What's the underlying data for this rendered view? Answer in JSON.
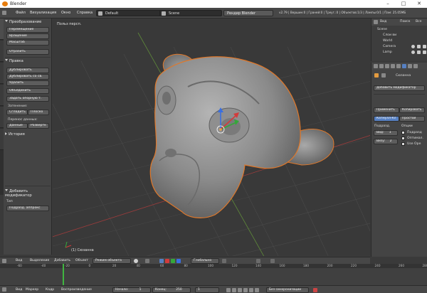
{
  "window": {
    "title": "Blender"
  },
  "menu": {
    "items": [
      "Файл",
      "Визуализация",
      "Окно",
      "Справка"
    ],
    "layout": "Default",
    "scene": "Scene",
    "engine": "Рендер Blender",
    "stats": "v2.79 | Вершин:0 | Граней:0 | Треуг.:0 | Объектов:1/3 | Лампы:0/1 | Пам: 25.05МБ"
  },
  "tools": {
    "transform_header": "Преобразование",
    "move": "Перемещение",
    "rotate": "Вращение",
    "scale": "Масштаб",
    "mirror": "Отразить",
    "edit_header": "Правка",
    "duplicate": "Дублировать",
    "duplicate_linked": "Дублировать со св.",
    "delete": "Удалить",
    "join": "Объединить",
    "set_origin": "Задать опорную т.",
    "shading_label": "Затенение:",
    "smooth": "Сгладить",
    "flat": "Плоско",
    "data_transfer_label": "Перенос данных:",
    "data": "Данные",
    "layout_btn": "Развёртк",
    "history_header": "История",
    "add_modifier_header": "Добавить модификатор",
    "type_label": "Тип",
    "type_value": "Подразд. аппрокс"
  },
  "viewport": {
    "view_label": "Польз персп.",
    "object_label": "(1) Сюзанна",
    "header": {
      "view": "Вид",
      "select": "Выделение",
      "add": "Добавить",
      "object": "Объект",
      "mode": "Режим объекта",
      "pivot": "Глобально"
    }
  },
  "timeline": {
    "ticks": [
      "-60",
      "-40",
      "-20",
      "0",
      "20",
      "40",
      "60",
      "80",
      "100",
      "120",
      "140",
      "160",
      "180",
      "200",
      "220",
      "240",
      "260",
      "280"
    ],
    "footer": {
      "view": "Вид",
      "marker": "Маркер",
      "frame": "Кадр",
      "playback": "Воспроизведение",
      "start": "Начало:",
      "start_value": "1",
      "end": "Конец:",
      "end_value": "250",
      "current": "1",
      "sync": "Без синхронизации"
    }
  },
  "outliner": {
    "tabs": [
      "Вид",
      "Поиск",
      "Все"
    ],
    "tree": [
      "Scene",
      "Слои ви",
      "World",
      "Camera",
      "Lamp"
    ]
  },
  "properties": {
    "object_name": "Сюзанна",
    "add_modifier": "Добавить модификатор",
    "apply": "Применить",
    "copy": "Копировать",
    "catmull": "Катмулл-Кл",
    "simple": "Простой",
    "subdivisions": "Подразд.",
    "options": "Опции",
    "view_label": "Вид:",
    "view_value": "1",
    "render_label": "Визу:",
    "render_value": "2",
    "opt_subdiv": "Подразд",
    "opt_optimal": "Оптимал.",
    "opt_opensubdiv": "Use Ope"
  }
}
